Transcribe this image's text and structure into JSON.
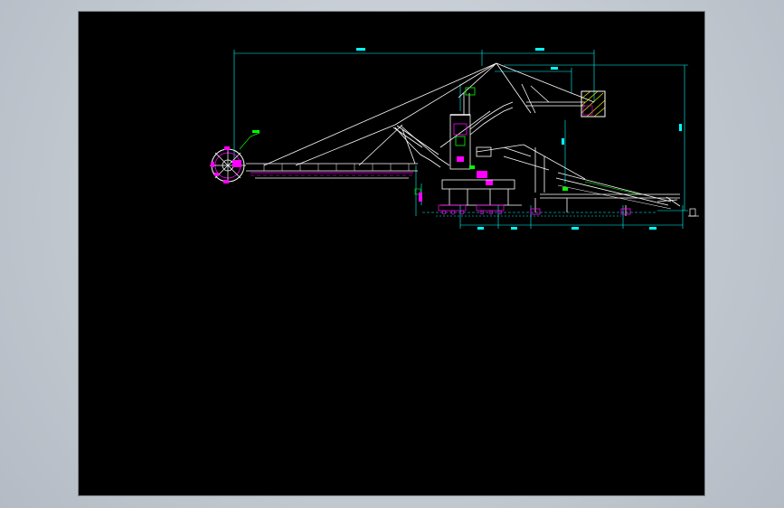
{
  "drawing": {
    "background": "#000000",
    "frame_color": "#c3c9d1",
    "colors": {
      "structure": "#ffffff",
      "dimension": "#00ffff",
      "highlight": "#ff00ff",
      "accent_green": "#00ff00",
      "accent_yellow": "#ffff00"
    }
  }
}
